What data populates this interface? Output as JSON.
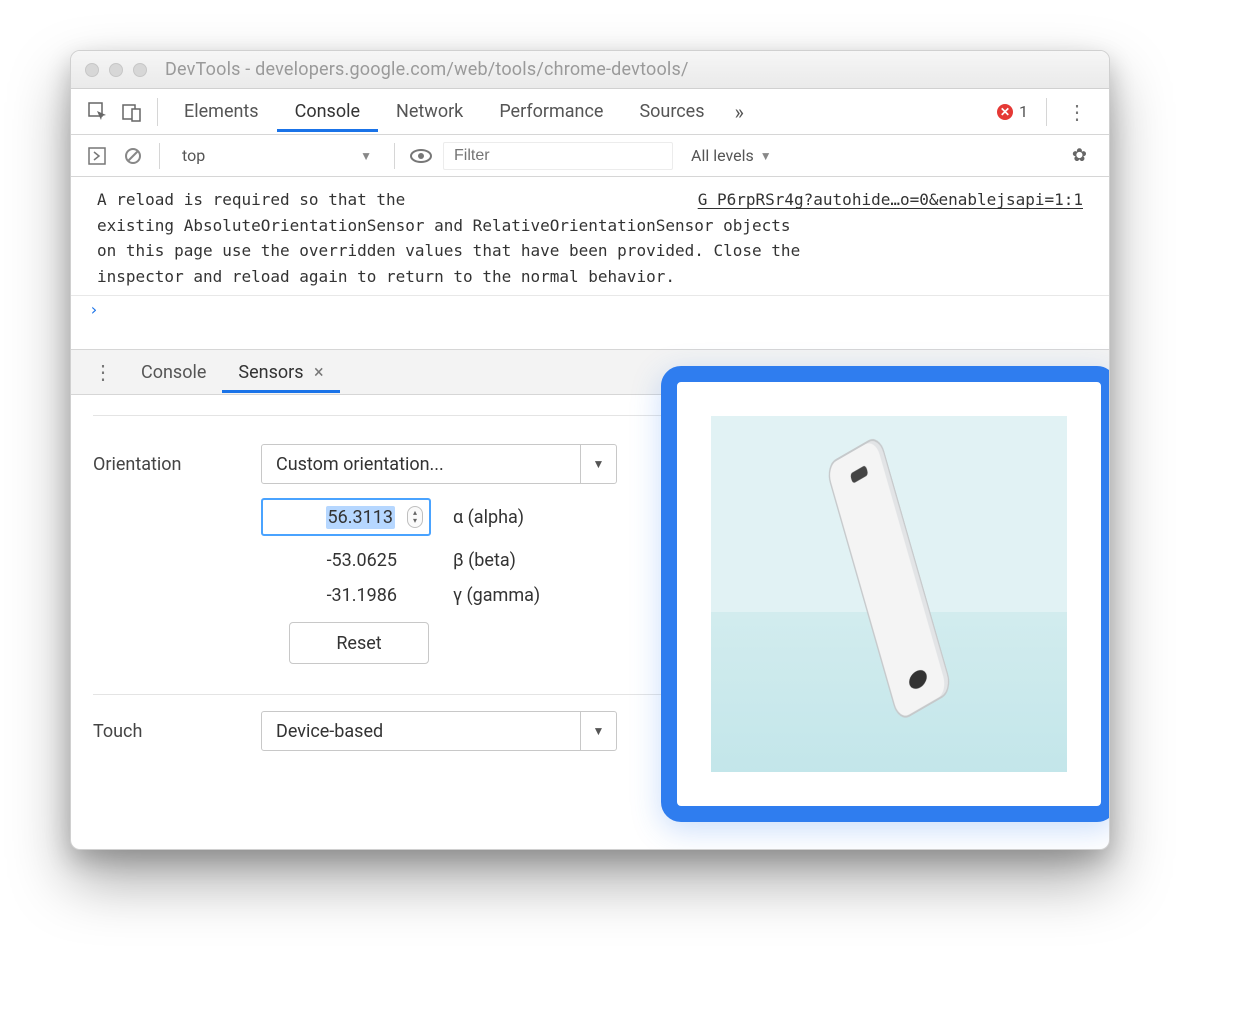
{
  "window": {
    "title": "DevTools - developers.google.com/web/tools/chrome-devtools/"
  },
  "tabs": {
    "items": [
      "Elements",
      "Console",
      "Network",
      "Performance",
      "Sources"
    ],
    "active": "Console",
    "more_glyph": "»",
    "error_count": "1"
  },
  "console_toolbar": {
    "context": "top",
    "filter_placeholder": "Filter",
    "levels": "All levels"
  },
  "console_message": {
    "right_link": "G P6rpRSr4g?autohide…o=0&enablejsapi=1:1",
    "text_line1": "A reload is required so that the",
    "text_line2": "existing AbsoluteOrientationSensor and RelativeOrientationSensor objects",
    "text_line3": "on this page use the overridden values that have been provided. Close the",
    "text_line4": "inspector and reload again to return to the normal behavior."
  },
  "drawer": {
    "tabs": [
      "Console",
      "Sensors"
    ],
    "active": "Sensors"
  },
  "sensors": {
    "orientation_label": "Orientation",
    "orientation_select": "Custom orientation...",
    "alpha": {
      "value": "56.3113",
      "label": "α (alpha)"
    },
    "beta": {
      "value": "-53.0625",
      "label": "β (beta)"
    },
    "gamma": {
      "value": "-31.1986",
      "label": "γ (gamma)"
    },
    "reset": "Reset",
    "touch_label": "Touch",
    "touch_select": "Device-based"
  }
}
